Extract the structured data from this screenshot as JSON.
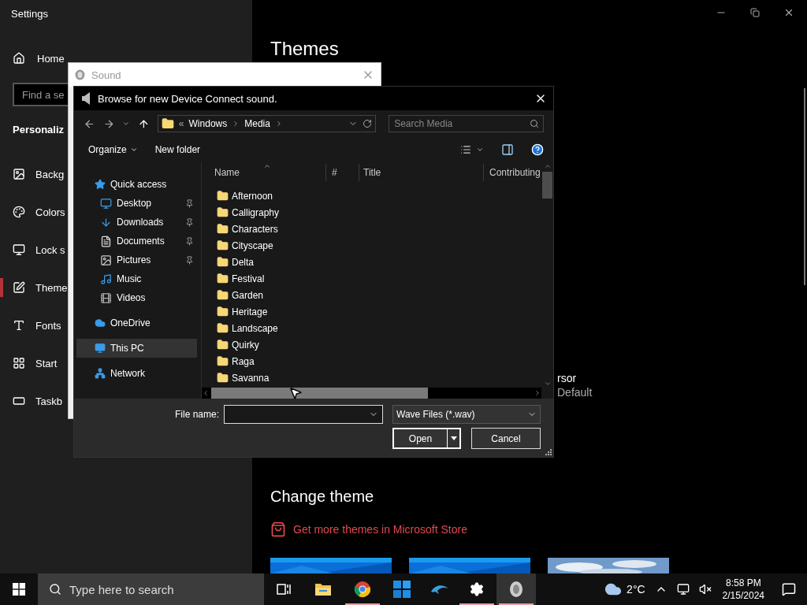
{
  "settings": {
    "title": "Settings",
    "home": "Home",
    "search": {
      "placeholder": "Find a se"
    },
    "section": "Personaliz",
    "nav": [
      {
        "label": "Backg",
        "selected": false
      },
      {
        "label": "Colors",
        "selected": false
      },
      {
        "label": "Lock s",
        "selected": false
      },
      {
        "label": "Theme",
        "selected": true
      },
      {
        "label": "Fonts",
        "selected": false
      },
      {
        "label": "Start",
        "selected": false
      },
      {
        "label": "Taskb",
        "selected": false
      }
    ],
    "content": {
      "heading": "Themes",
      "cursor_label": "rsor",
      "cursor_value": "Default",
      "change_theme": "Change theme",
      "store_link": "Get more themes in Microsoft Store"
    }
  },
  "sound_window": {
    "title": "Sound"
  },
  "dialog": {
    "title": "Browse for new Device Connect sound.",
    "path_overflow": "«",
    "path": [
      "Windows",
      "Media"
    ],
    "search": {
      "placeholder": "Search Media"
    },
    "toolbar": [
      "Organize",
      "New folder"
    ],
    "tree": [
      {
        "label": "Quick access",
        "selected": false,
        "children": [
          {
            "label": "Desktop",
            "pinned": true
          },
          {
            "label": "Downloads",
            "pinned": true
          },
          {
            "label": "Documents",
            "pinned": true
          },
          {
            "label": "Pictures",
            "pinned": true
          },
          {
            "label": "Music",
            "pinned": false
          },
          {
            "label": "Videos",
            "pinned": false
          }
        ]
      },
      {
        "label": "OneDrive",
        "selected": false
      },
      {
        "label": "This PC",
        "selected": true
      },
      {
        "label": "Network",
        "selected": false
      }
    ],
    "columns": [
      "Name",
      "#",
      "Title",
      "Contributing"
    ],
    "files": [
      "Afternoon",
      "Calligraphy",
      "Characters",
      "Cityscape",
      "Delta",
      "Festival",
      "Garden",
      "Heritage",
      "Landscape",
      "Quirky",
      "Raga",
      "Savanna"
    ],
    "file_name_label": "File name:",
    "filter": "Wave Files (*.wav)",
    "buttons": [
      "Open",
      "Cancel"
    ]
  },
  "taskbar": {
    "search": {
      "placeholder": "Type here to search"
    },
    "apps": [
      {
        "running": false,
        "selected": false
      },
      {
        "running": false,
        "selected": false
      },
      {
        "running": true,
        "selected": false
      },
      {
        "running": false,
        "selected": false
      },
      {
        "running": false,
        "selected": false
      },
      {
        "running": true,
        "selected": false
      },
      {
        "running": true,
        "selected": true
      }
    ],
    "weather": "2°C",
    "time": "8:58 PM",
    "date": "2/15/2024"
  }
}
